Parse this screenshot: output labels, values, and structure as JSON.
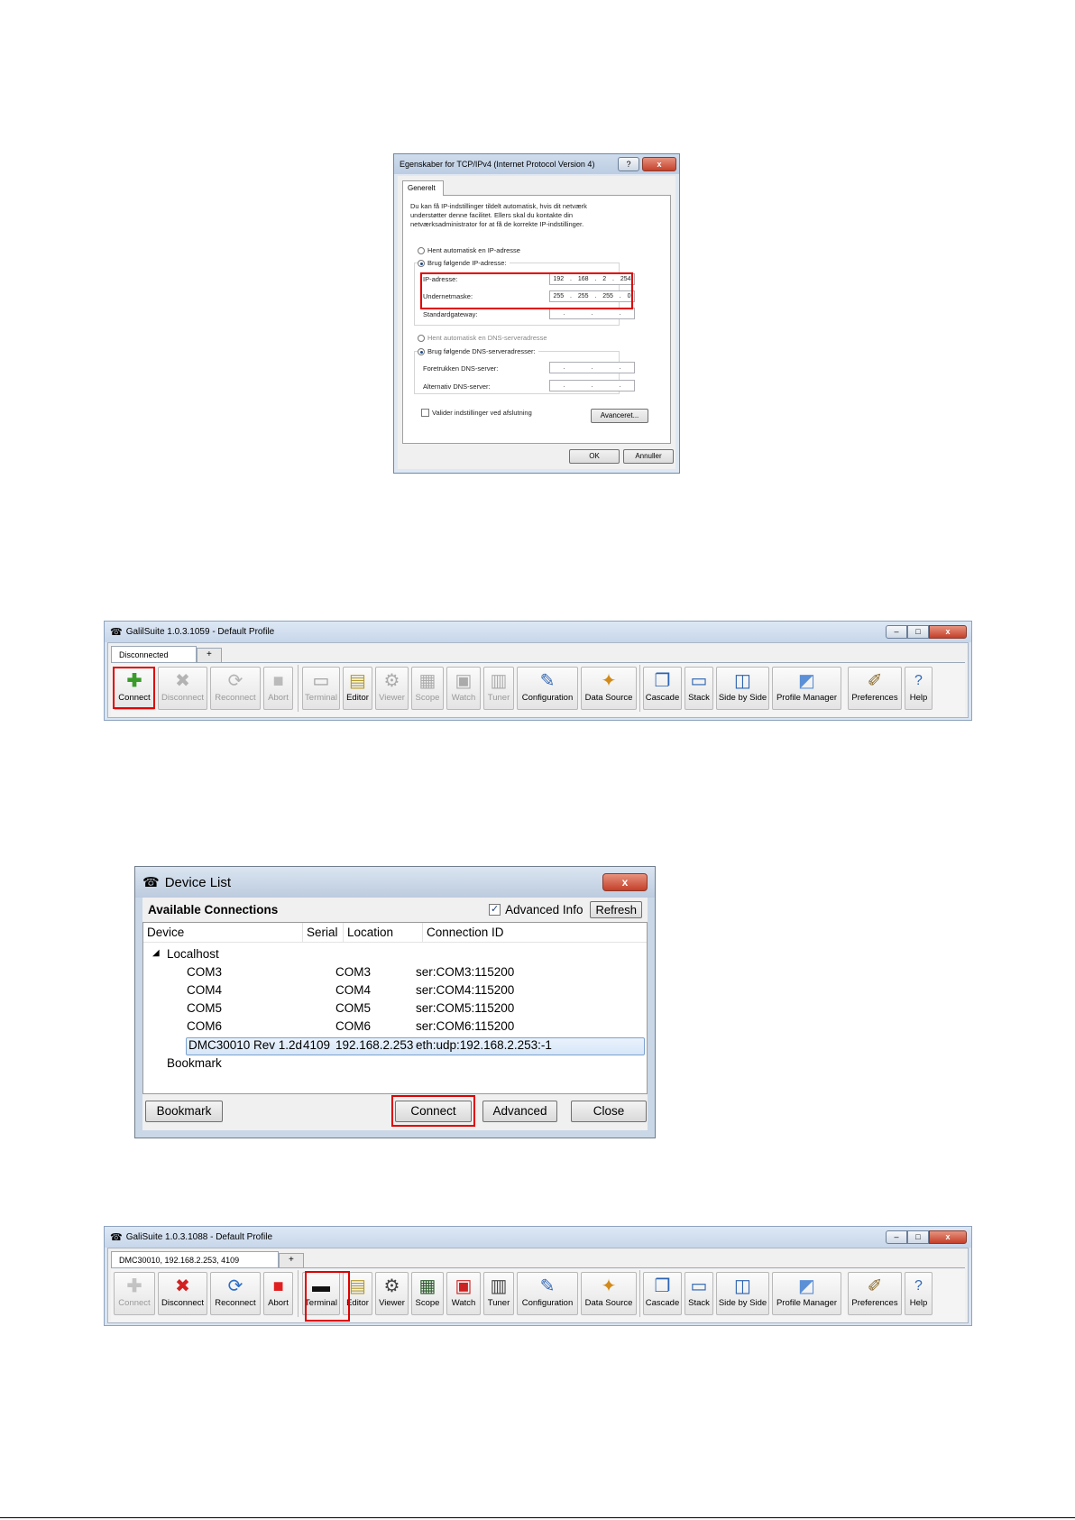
{
  "tcp_dialog": {
    "title": "Egenskaber for TCP/IPv4 (Internet Protocol Version 4)",
    "help_btn": "?",
    "close_btn": "x",
    "tab": "Generelt",
    "intro": "Du kan få IP-indstillinger tildelt automatisk, hvis dit netværk understøtter denne facilitet. Ellers skal du kontakte din netværksadministrator for at få de korrekte IP-indstillinger.",
    "radio_auto_ip": "Hent automatisk en IP-adresse",
    "radio_manual_ip": "Brug følgende IP-adresse:",
    "ip_label": "IP-adresse:",
    "ip_value": [
      "192",
      "168",
      "2",
      "254"
    ],
    "mask_label": "Undernetmaske:",
    "mask_value": [
      "255",
      "255",
      "255",
      "0"
    ],
    "gateway_label": "Standardgateway:",
    "gateway_value": [
      ".",
      ".",
      "."
    ],
    "radio_auto_dns": "Hent automatisk en DNS-serveradresse",
    "radio_manual_dns": "Brug følgende DNS-serveradresser:",
    "dns1_label": "Foretrukken DNS-server:",
    "dns2_label": "Alternativ DNS-server:",
    "validate_label": "Valider indstillinger ved afslutning",
    "advanced_btn": "Avanceret...",
    "ok_btn": "OK",
    "cancel_btn": "Annuller"
  },
  "toolbar1": {
    "title": "GalilSuite 1.0.3.1059 - Default Profile",
    "tab": "Disconnected",
    "plus_tab": "+",
    "win_min": "–",
    "win_max": "□",
    "win_close": "x",
    "tools": [
      "Connect",
      "Disconnect",
      "Reconnect",
      "Abort",
      "Terminal",
      "Editor",
      "Viewer",
      "Scope",
      "Watch",
      "Tuner",
      "Configuration",
      "Data Source",
      "Cascade",
      "Stack",
      "Side by Side",
      "Profile Manager",
      "Preferences",
      "Help"
    ]
  },
  "device_list": {
    "title": "Device List",
    "close_btn": "x",
    "header": "Available Connections",
    "advanced_info_label": "Advanced Info",
    "advanced_info_checked": true,
    "refresh_btn": "Refresh",
    "columns": [
      "Device",
      "Serial",
      "Location",
      "Connection ID"
    ],
    "group_localhost": "Localhost",
    "rows": [
      {
        "device": "COM3",
        "serial": "",
        "location": "COM3",
        "conn": "ser:COM3:115200"
      },
      {
        "device": "COM4",
        "serial": "",
        "location": "COM4",
        "conn": "ser:COM4:115200"
      },
      {
        "device": "COM5",
        "serial": "",
        "location": "COM5",
        "conn": "ser:COM5:115200"
      },
      {
        "device": "COM6",
        "serial": "",
        "location": "COM6",
        "conn": "ser:COM6:115200"
      },
      {
        "device": "DMC30010 Rev 1.2d",
        "serial": "4109",
        "location": "192.168.2.253",
        "conn": "eth:udp:192.168.2.253:-1"
      }
    ],
    "group_bookmark": "Bookmark",
    "bookmark_btn": "Bookmark",
    "connect_btn": "Connect",
    "advanced_btn": "Advanced",
    "close_btn_label": "Close"
  },
  "toolbar2": {
    "title": "GaliSuite 1.0.3.1088 - Default Profile",
    "tab": "DMC30010, 192.168.2.253, 4109",
    "plus_tab": "+",
    "win_min": "–",
    "win_max": "□",
    "win_close": "x",
    "tools": [
      "Connect",
      "Disconnect",
      "Reconnect",
      "Abort",
      "Terminal",
      "Editor",
      "Viewer",
      "Scope",
      "Watch",
      "Tuner",
      "Configuration",
      "Data Source",
      "Cascade",
      "Stack",
      "Side by Side",
      "Profile Manager",
      "Preferences",
      "Help"
    ]
  },
  "colors": {
    "highlight_red": "#e00000",
    "selection_blue": "#d6e6f8"
  }
}
